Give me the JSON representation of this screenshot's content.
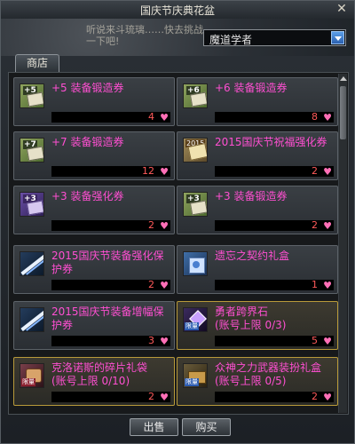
{
  "window": {
    "title": "国庆节庆典花盆"
  },
  "notice_text": "听说来斗琉璃……快去挑战一下吧!",
  "dropdown": {
    "selected": "魔道学者"
  },
  "tabs": [
    {
      "label": "商店"
    }
  ],
  "items": [
    {
      "name": "+5 装备锻造券",
      "price": "4",
      "icon": "plus5-smith-ticket-icon",
      "icon_badge": "+5"
    },
    {
      "name": "+6 装备锻造券",
      "price": "8",
      "icon": "plus6-smith-ticket-icon",
      "icon_badge": "+6"
    },
    {
      "name": "+7 装备锻造券",
      "price": "12",
      "icon": "plus7-smith-ticket-icon",
      "icon_badge": "+7"
    },
    {
      "name": "2015国庆节祝福强化券",
      "price": "2",
      "icon": "blessing-ticket-icon",
      "icon_badge": "2015"
    },
    {
      "name": "+3 装备强化券",
      "price": "2",
      "icon": "plus3-enhance-ticket-icon",
      "icon_badge": "+3"
    },
    {
      "name": "+3 装备锻造券",
      "price": "2",
      "icon": "plus3-smith-ticket-icon",
      "icon_badge": "+3"
    },
    {
      "name": "2015国庆节装备强化保护券",
      "price": "2",
      "icon": "protect-ticket-icon"
    },
    {
      "name": "遗忘之契约礼盒",
      "price": "1",
      "icon": "contract-box-icon"
    },
    {
      "name": "2015国庆节装备增幅保护券",
      "price": "3",
      "icon": "amplify-protect-ticket-icon"
    },
    {
      "name": "勇者跨界石",
      "sub": "(账号上限 0/3)",
      "price": "5",
      "icon": "hero-stone-icon",
      "icon_tag": "限量"
    },
    {
      "name": "克洛诺斯的碎片礼袋",
      "sub": "(账号上限 0/10)",
      "price": "2",
      "icon": "fragment-bag-icon",
      "icon_tag": "限量"
    },
    {
      "name": "众神之力武器装扮礼盒",
      "sub": "(账号上限 0/5)",
      "price": "2",
      "icon": "weapon-avatar-box-icon",
      "icon_tag": "限量"
    }
  ],
  "buttons": {
    "sell": "出售",
    "buy": "购买"
  },
  "colors": {
    "item_name": "#ff4fd2",
    "price": "#ff5a5a",
    "heart": "#ff6fb7"
  }
}
